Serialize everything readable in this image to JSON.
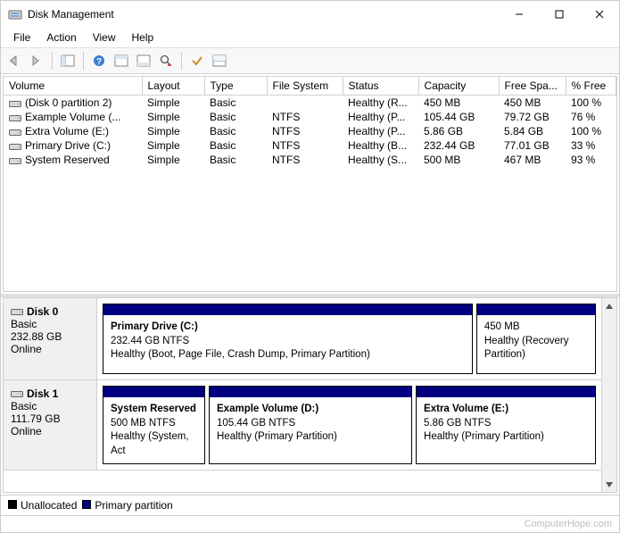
{
  "window": {
    "title": "Disk Management",
    "min": "—",
    "max": "☐",
    "close": "✕"
  },
  "menu": [
    "File",
    "Action",
    "View",
    "Help"
  ],
  "columns": [
    "Volume",
    "Layout",
    "Type",
    "File System",
    "Status",
    "Capacity",
    "Free Spa...",
    "% Free"
  ],
  "volumes": [
    {
      "name": "(Disk 0 partition 2)",
      "layout": "Simple",
      "type": "Basic",
      "fs": "",
      "status": "Healthy (R...",
      "cap": "450 MB",
      "free": "450 MB",
      "pct": "100 %"
    },
    {
      "name": "Example Volume (...",
      "layout": "Simple",
      "type": "Basic",
      "fs": "NTFS",
      "status": "Healthy (P...",
      "cap": "105.44 GB",
      "free": "79.72 GB",
      "pct": "76 %"
    },
    {
      "name": "Extra Volume (E:)",
      "layout": "Simple",
      "type": "Basic",
      "fs": "NTFS",
      "status": "Healthy (P...",
      "cap": "5.86 GB",
      "free": "5.84 GB",
      "pct": "100 %"
    },
    {
      "name": "Primary Drive (C:)",
      "layout": "Simple",
      "type": "Basic",
      "fs": "NTFS",
      "status": "Healthy (B...",
      "cap": "232.44 GB",
      "free": "77.01 GB",
      "pct": "33 %"
    },
    {
      "name": "System Reserved",
      "layout": "Simple",
      "type": "Basic",
      "fs": "NTFS",
      "status": "Healthy (S...",
      "cap": "500 MB",
      "free": "467 MB",
      "pct": "93 %"
    }
  ],
  "disks": [
    {
      "name": "Disk 0",
      "type": "Basic",
      "size": "232.88 GB",
      "status": "Online",
      "partitions": [
        {
          "title": "Primary Drive  (C:)",
          "sub": "232.44 GB NTFS",
          "health": "Healthy (Boot, Page File, Crash Dump, Primary Partition)",
          "flex": 5
        },
        {
          "title": "",
          "sub": "450 MB",
          "health": "Healthy (Recovery Partition)",
          "flex": 1.6
        }
      ]
    },
    {
      "name": "Disk 1",
      "type": "Basic",
      "size": "111.79 GB",
      "status": "Online",
      "partitions": [
        {
          "title": "System Reserved",
          "sub": "500 MB NTFS",
          "health": "Healthy (System, Act",
          "flex": 1.3
        },
        {
          "title": "Example Volume  (D:)",
          "sub": "105.44 GB NTFS",
          "health": "Healthy (Primary Partition)",
          "flex": 2.6
        },
        {
          "title": "Extra Volume  (E:)",
          "sub": "5.86 GB NTFS",
          "health": "Healthy (Primary Partition)",
          "flex": 2.3
        }
      ]
    }
  ],
  "legend": {
    "unallocated": "Unallocated",
    "primary": "Primary partition"
  },
  "footer": "ComputerHope.com",
  "colors": {
    "primary_partition": "#000080",
    "unallocated": "#000000"
  }
}
